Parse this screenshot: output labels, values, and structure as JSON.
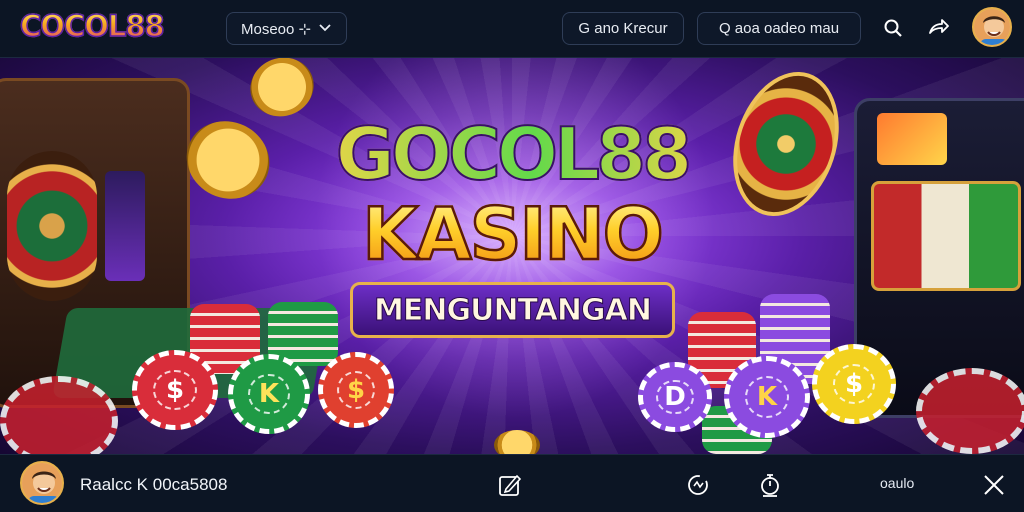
{
  "header": {
    "logo_text": "COCOL88",
    "dropdown_label": "Moseoo ⊹",
    "button_1_label": "G ano Krecur",
    "button_2_label": "Q aoa oadeo mau",
    "icons": [
      "search-icon",
      "share-icon",
      "user-avatar"
    ]
  },
  "banner": {
    "headline_1": "GOCOL88",
    "headline_2": "KASINO",
    "headline_3": "MENGUNTANGAN",
    "chips_left": [
      "$",
      "K",
      "$"
    ],
    "chips_right": [
      "D",
      "K",
      "$"
    ]
  },
  "footer": {
    "user_name": "Raalcc K 00ca5808",
    "right_label": "oaulo",
    "icons": [
      "edit-icon",
      "refresh-icon",
      "timer-icon",
      "close-icon"
    ]
  },
  "colors": {
    "bar_bg": "#0c1524",
    "banner_purple": "#5a1fa8",
    "gold": "#ffcf2a",
    "accent_border": "#2f3d57"
  }
}
